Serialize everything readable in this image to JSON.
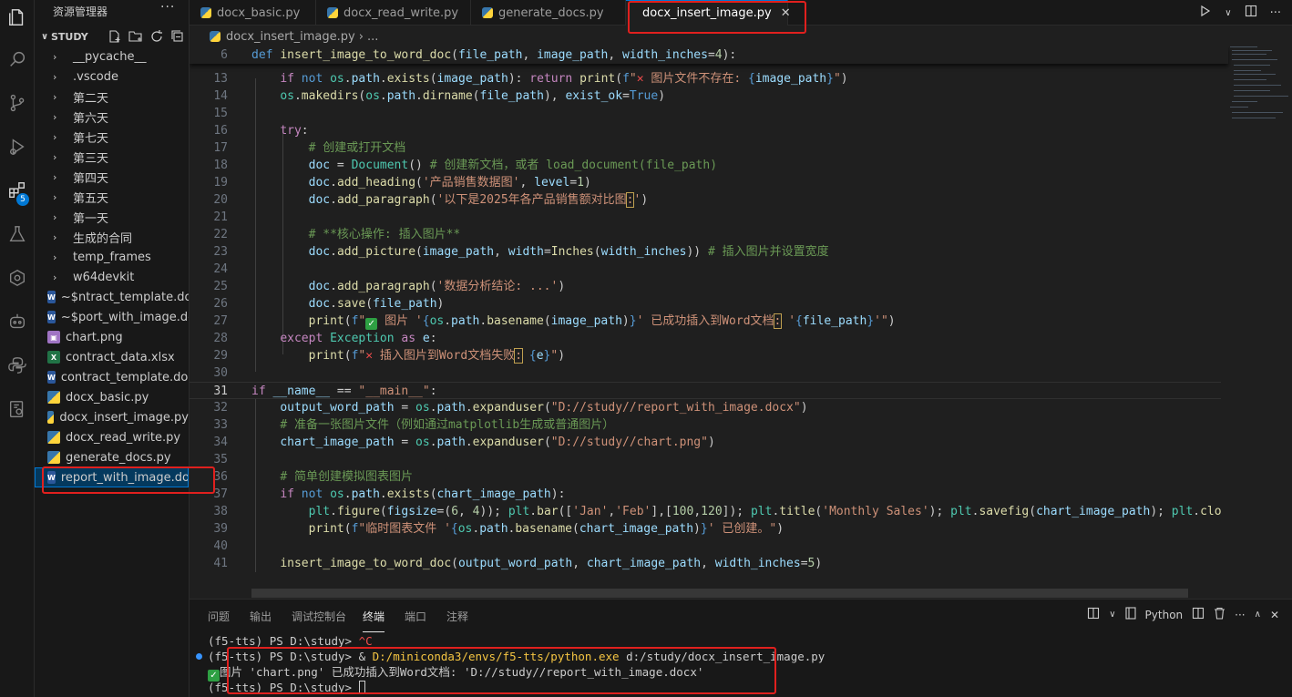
{
  "sidebar": {
    "title": "资源管理器",
    "more": "···",
    "root": "STUDY",
    "folders": [
      "__pycache__",
      ".vscode",
      "第二天",
      "第六天",
      "第七天",
      "第三天",
      "第四天",
      "第五天",
      "第一天",
      "生成的合同",
      "temp_frames",
      "w64devkit"
    ],
    "files": [
      {
        "name": "~$ntract_template.docx",
        "type": "word"
      },
      {
        "name": "~$port_with_image.docx",
        "type": "word"
      },
      {
        "name": "chart.png",
        "type": "img"
      },
      {
        "name": "contract_data.xlsx",
        "type": "excel"
      },
      {
        "name": "contract_template.docx",
        "type": "word"
      },
      {
        "name": "docx_basic.py",
        "type": "py"
      },
      {
        "name": "docx_insert_image.py",
        "type": "py"
      },
      {
        "name": "docx_read_write.py",
        "type": "py"
      },
      {
        "name": "generate_docs.py",
        "type": "py"
      },
      {
        "name": "report_with_image.docx",
        "type": "word"
      }
    ]
  },
  "activity": {
    "extensions_badge": "5"
  },
  "tabs": [
    {
      "label": "docx_basic.py"
    },
    {
      "label": "docx_read_write.py"
    },
    {
      "label": "generate_docs.py"
    },
    {
      "label": "docx_insert_image.py",
      "close": "✕"
    }
  ],
  "breadcrumb": {
    "file": "docx_insert_image.py",
    "sep": "› ..."
  },
  "code": {
    "sticky_num": "6",
    "line_numbers": [
      "13",
      "14",
      "15",
      "16",
      "17",
      "18",
      "19",
      "20",
      "21",
      "22",
      "23",
      "24",
      "25",
      "26",
      "27",
      "28",
      "29",
      "30",
      "31",
      "32",
      "33",
      "34",
      "35",
      "36",
      "37",
      "38",
      "39",
      "40",
      "41"
    ]
  },
  "panel": {
    "tabs": [
      "问题",
      "输出",
      "调试控制台",
      "终端",
      "端口",
      "注释"
    ],
    "shell": "Python",
    "terminal": {
      "l1_prompt": "(f5-tts) PS D:\\study> ",
      "l1_cmd": "^C",
      "l2_prompt": "(f5-tts) PS D:\\study> & ",
      "l2_exe": "D:/miniconda3/envs/f5-tts/python.exe",
      "l2_arg": " d:/study/docx_insert_image.py",
      "l3_check": "✓",
      "l3_text": "图片 'chart.png' 已成功插入到Word文档: 'D://study//report_with_image.docx'",
      "l4_prompt": "(f5-tts) PS D:\\study> "
    }
  }
}
